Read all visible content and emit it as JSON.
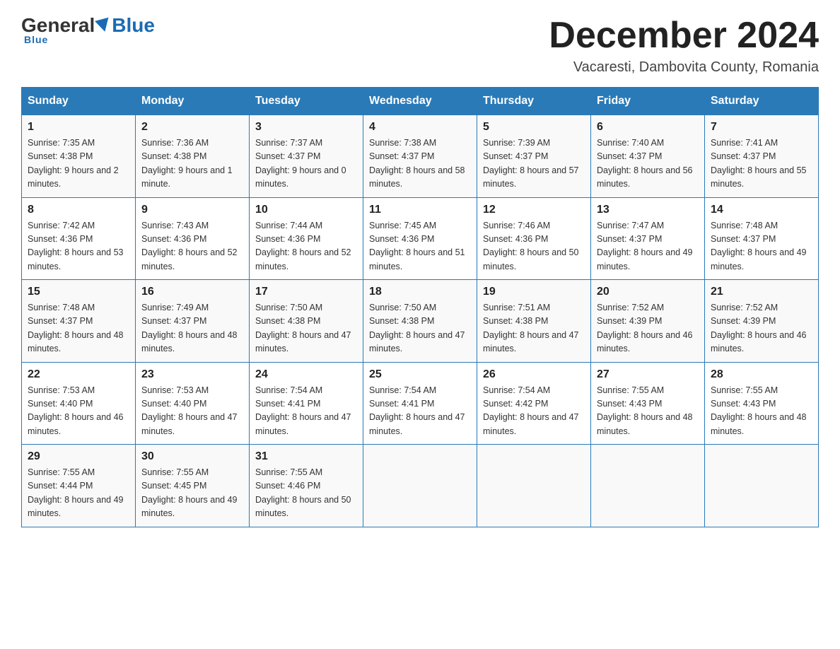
{
  "header": {
    "logo_general": "General",
    "logo_blue": "Blue",
    "main_title": "December 2024",
    "subtitle": "Vacaresti, Dambovita County, Romania"
  },
  "calendar": {
    "days_of_week": [
      "Sunday",
      "Monday",
      "Tuesday",
      "Wednesday",
      "Thursday",
      "Friday",
      "Saturday"
    ],
    "weeks": [
      [
        {
          "day": "1",
          "sunrise": "7:35 AM",
          "sunset": "4:38 PM",
          "daylight": "9 hours and 2 minutes."
        },
        {
          "day": "2",
          "sunrise": "7:36 AM",
          "sunset": "4:38 PM",
          "daylight": "9 hours and 1 minute."
        },
        {
          "day": "3",
          "sunrise": "7:37 AM",
          "sunset": "4:37 PM",
          "daylight": "9 hours and 0 minutes."
        },
        {
          "day": "4",
          "sunrise": "7:38 AM",
          "sunset": "4:37 PM",
          "daylight": "8 hours and 58 minutes."
        },
        {
          "day": "5",
          "sunrise": "7:39 AM",
          "sunset": "4:37 PM",
          "daylight": "8 hours and 57 minutes."
        },
        {
          "day": "6",
          "sunrise": "7:40 AM",
          "sunset": "4:37 PM",
          "daylight": "8 hours and 56 minutes."
        },
        {
          "day": "7",
          "sunrise": "7:41 AM",
          "sunset": "4:37 PM",
          "daylight": "8 hours and 55 minutes."
        }
      ],
      [
        {
          "day": "8",
          "sunrise": "7:42 AM",
          "sunset": "4:36 PM",
          "daylight": "8 hours and 53 minutes."
        },
        {
          "day": "9",
          "sunrise": "7:43 AM",
          "sunset": "4:36 PM",
          "daylight": "8 hours and 52 minutes."
        },
        {
          "day": "10",
          "sunrise": "7:44 AM",
          "sunset": "4:36 PM",
          "daylight": "8 hours and 52 minutes."
        },
        {
          "day": "11",
          "sunrise": "7:45 AM",
          "sunset": "4:36 PM",
          "daylight": "8 hours and 51 minutes."
        },
        {
          "day": "12",
          "sunrise": "7:46 AM",
          "sunset": "4:36 PM",
          "daylight": "8 hours and 50 minutes."
        },
        {
          "day": "13",
          "sunrise": "7:47 AM",
          "sunset": "4:37 PM",
          "daylight": "8 hours and 49 minutes."
        },
        {
          "day": "14",
          "sunrise": "7:48 AM",
          "sunset": "4:37 PM",
          "daylight": "8 hours and 49 minutes."
        }
      ],
      [
        {
          "day": "15",
          "sunrise": "7:48 AM",
          "sunset": "4:37 PM",
          "daylight": "8 hours and 48 minutes."
        },
        {
          "day": "16",
          "sunrise": "7:49 AM",
          "sunset": "4:37 PM",
          "daylight": "8 hours and 48 minutes."
        },
        {
          "day": "17",
          "sunrise": "7:50 AM",
          "sunset": "4:38 PM",
          "daylight": "8 hours and 47 minutes."
        },
        {
          "day": "18",
          "sunrise": "7:50 AM",
          "sunset": "4:38 PM",
          "daylight": "8 hours and 47 minutes."
        },
        {
          "day": "19",
          "sunrise": "7:51 AM",
          "sunset": "4:38 PM",
          "daylight": "8 hours and 47 minutes."
        },
        {
          "day": "20",
          "sunrise": "7:52 AM",
          "sunset": "4:39 PM",
          "daylight": "8 hours and 46 minutes."
        },
        {
          "day": "21",
          "sunrise": "7:52 AM",
          "sunset": "4:39 PM",
          "daylight": "8 hours and 46 minutes."
        }
      ],
      [
        {
          "day": "22",
          "sunrise": "7:53 AM",
          "sunset": "4:40 PM",
          "daylight": "8 hours and 46 minutes."
        },
        {
          "day": "23",
          "sunrise": "7:53 AM",
          "sunset": "4:40 PM",
          "daylight": "8 hours and 47 minutes."
        },
        {
          "day": "24",
          "sunrise": "7:54 AM",
          "sunset": "4:41 PM",
          "daylight": "8 hours and 47 minutes."
        },
        {
          "day": "25",
          "sunrise": "7:54 AM",
          "sunset": "4:41 PM",
          "daylight": "8 hours and 47 minutes."
        },
        {
          "day": "26",
          "sunrise": "7:54 AM",
          "sunset": "4:42 PM",
          "daylight": "8 hours and 47 minutes."
        },
        {
          "day": "27",
          "sunrise": "7:55 AM",
          "sunset": "4:43 PM",
          "daylight": "8 hours and 48 minutes."
        },
        {
          "day": "28",
          "sunrise": "7:55 AM",
          "sunset": "4:43 PM",
          "daylight": "8 hours and 48 minutes."
        }
      ],
      [
        {
          "day": "29",
          "sunrise": "7:55 AM",
          "sunset": "4:44 PM",
          "daylight": "8 hours and 49 minutes."
        },
        {
          "day": "30",
          "sunrise": "7:55 AM",
          "sunset": "4:45 PM",
          "daylight": "8 hours and 49 minutes."
        },
        {
          "day": "31",
          "sunrise": "7:55 AM",
          "sunset": "4:46 PM",
          "daylight": "8 hours and 50 minutes."
        },
        null,
        null,
        null,
        null
      ]
    ]
  }
}
